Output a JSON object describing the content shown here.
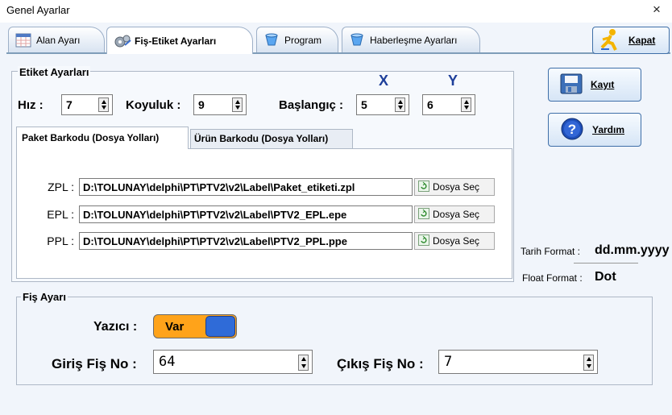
{
  "window": {
    "title": "Genel Ayarlar",
    "close_glyph": "×"
  },
  "tabs": [
    {
      "label": "Alan Ayarı",
      "icon": "grid-icon"
    },
    {
      "label": "Fiş-Etiket Ayarları",
      "icon": "gears-icon"
    },
    {
      "label": "Program",
      "icon": "blue-cup-icon"
    },
    {
      "label": "Haberleşme Ayarları",
      "icon": "blue-cup-icon"
    }
  ],
  "active_tab": "Fiş-Etiket Ayarları",
  "buttons": {
    "kapat": "Kapat",
    "kayit": "Kayıt",
    "yardim": "Yardım"
  },
  "etiket": {
    "title": "Etiket Ayarları",
    "hiz_label": "Hız :",
    "hiz_value": "7",
    "koyuluk_label": "Koyuluk :",
    "koyuluk_value": "9",
    "baslangic_label": "Başlangıç :",
    "x_header": "X",
    "y_header": "Y",
    "x_value": "5",
    "y_value": "6"
  },
  "subtabs": [
    "Paket Barkodu (Dosya Yolları)",
    "Ürün Barkodu (Dosya Yolları)"
  ],
  "paths": [
    {
      "label": "ZPL :",
      "value": "D:\\TOLUNAY\\delphi\\PT\\PTV2\\v2\\Label\\Paket_etiketi.zpl",
      "button": "Dosya Seç"
    },
    {
      "label": "EPL :",
      "value": "D:\\TOLUNAY\\delphi\\PT\\PTV2\\v2\\Label\\PTV2_EPL.epe",
      "button": "Dosya Seç"
    },
    {
      "label": "PPL :",
      "value": "D:\\TOLUNAY\\delphi\\PT\\PTV2\\v2\\Label\\PTV2_PPL.ppe",
      "button": "Dosya Seç"
    }
  ],
  "formats": {
    "tarih_label": "Tarih Format :",
    "tarih_value": "dd.mm.yyyy",
    "float_label": "Float Format :",
    "float_value": "Dot"
  },
  "fis": {
    "title": "Fiş Ayarı",
    "yazici_label": "Yazıcı :",
    "yazici_value": "Var",
    "giris_label": "Giriş Fiş No :",
    "giris_value": "64",
    "cikis_label": "Çıkış Fiş No :",
    "cikis_value": "7"
  },
  "colors": {
    "toggle_on": "#ffa31a",
    "toggle_knob": "#2f6bd8",
    "accent_border": "#3f6fa8"
  }
}
